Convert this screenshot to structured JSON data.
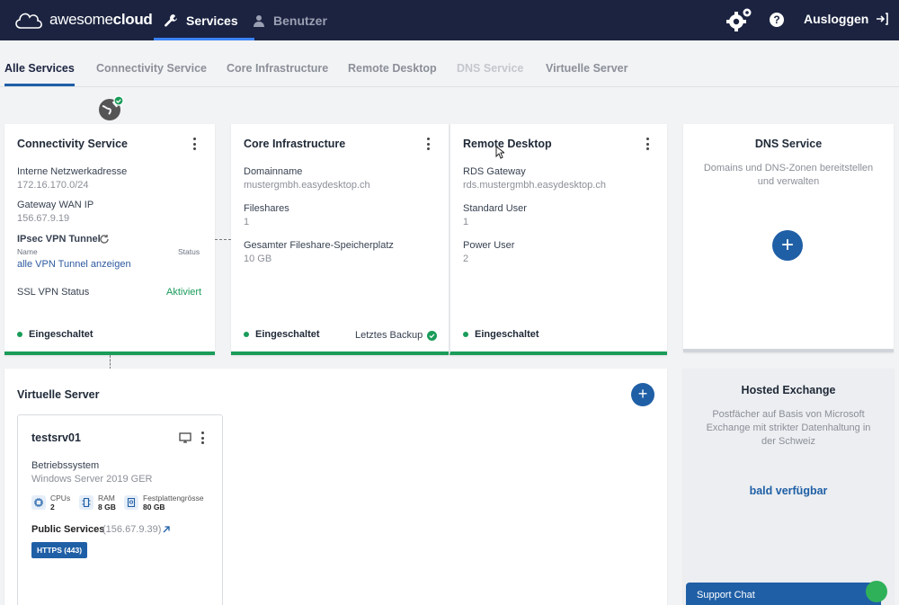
{
  "app": {
    "logo_text_light": "awesome",
    "logo_text_bold": "cloud"
  },
  "nav": {
    "services_label": "Services",
    "users_label": "Benutzer",
    "logout_label": "Ausloggen",
    "help_glyph": "?"
  },
  "tabs": [
    {
      "label": "Alle Services",
      "state": "active"
    },
    {
      "label": "Connectivity Service",
      "state": "normal"
    },
    {
      "label": "Core Infrastructure",
      "state": "normal"
    },
    {
      "label": "Remote Desktop",
      "state": "normal"
    },
    {
      "label": "DNS Service",
      "state": "disabled"
    },
    {
      "label": "Virtuelle Server",
      "state": "normal"
    }
  ],
  "connectivity": {
    "title": "Connectivity Service",
    "network_label": "Interne Netzwerkadresse",
    "network_value": "172.16.170.0/24",
    "wan_label": "Gateway WAN IP",
    "wan_value": "156.67.9.19",
    "ipsec_label": "IPsec VPN Tunnel",
    "col_name": "Name",
    "col_status": "Status",
    "tunnel_link": "alle VPN Tunnel anzeigen",
    "ssl_label": "SSL VPN Status",
    "ssl_value": "Aktiviert",
    "status": "Eingeschaltet"
  },
  "core": {
    "title": "Core Infrastructure",
    "domain_label": "Domainname",
    "domain_value": "mustergmbh.easydesktop.ch",
    "fileshares_label": "Fileshares",
    "fileshares_value": "1",
    "storage_label": "Gesamter Fileshare-Speicherplatz",
    "storage_value": "10 GB",
    "status": "Eingeschaltet",
    "backup_label": "Letztes Backup"
  },
  "remote": {
    "title": "Remote Desktop",
    "gateway_label": "RDS Gateway",
    "gateway_value": "rds.mustergmbh.easydesktop.ch",
    "standard_label": "Standard User",
    "standard_value": "1",
    "power_label": "Power User",
    "power_value": "2",
    "status": "Eingeschaltet"
  },
  "dns": {
    "title": "DNS Service",
    "desc_line1": "Domains und DNS-Zonen bereitstellen",
    "desc_line2": "und verwalten",
    "plus": "+"
  },
  "vservers": {
    "title": "Virtuelle Server",
    "plus": "+",
    "server": {
      "name": "testsrv01",
      "os_label": "Betriebssystem",
      "os_value": "Windows Server 2019 GER",
      "cpu_label": "CPUs",
      "cpu_value": "2",
      "ram_label": "RAM",
      "ram_value": "8 GB",
      "disk_label": "Festplattengrösse",
      "disk_value": "80 GB",
      "public_label": "Public Services",
      "public_ip": "(156.67.9.39)",
      "badge": "HTTPS (443)"
    }
  },
  "exchange": {
    "title": "Hosted Exchange",
    "desc_line1": "Postfächer auf Basis von Microsoft",
    "desc_line2": "Exchange mit strikter Datenhaltung in",
    "desc_line3": "der Schweiz",
    "availability": "bald verfügbar"
  },
  "support": {
    "label": "Support Chat"
  },
  "colors": {
    "nav_bg": "#1b2340",
    "accent_blue": "#1f5fa6",
    "status_green": "#1a9c5a"
  }
}
